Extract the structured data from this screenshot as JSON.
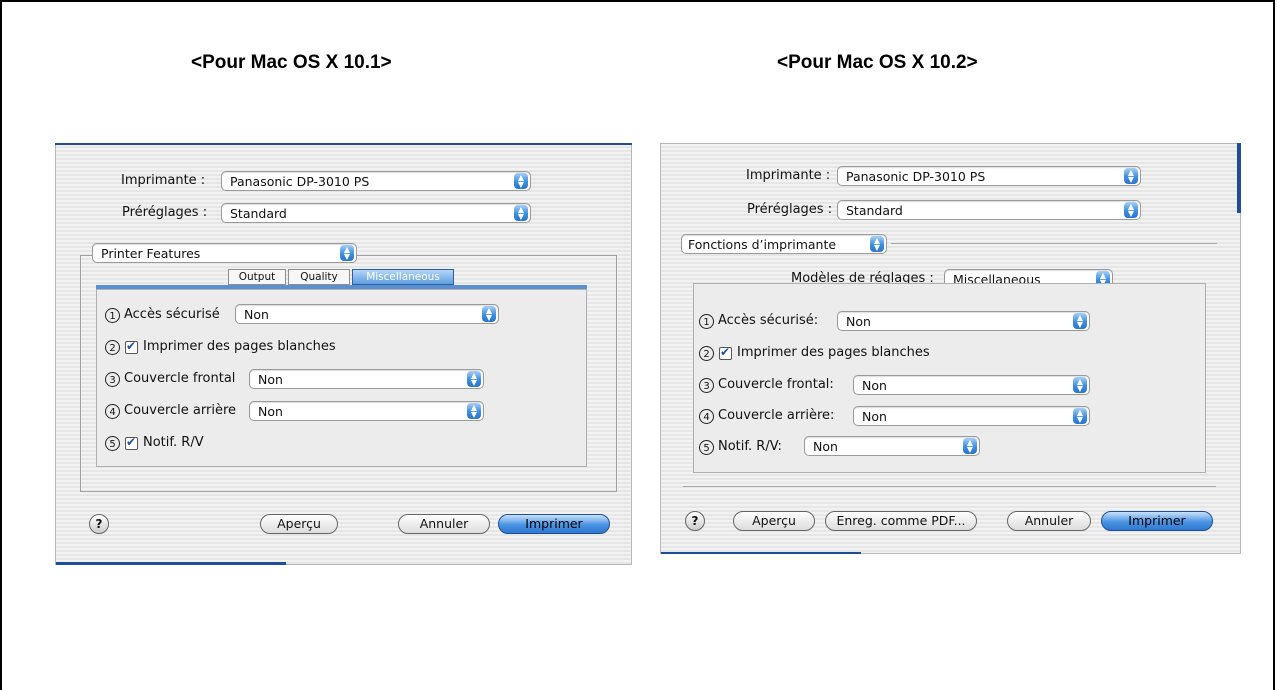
{
  "headings": {
    "left": "<Pour Mac OS X 10.1>",
    "right": "<Pour Mac OS X 10.2>"
  },
  "dialog1": {
    "printer_label": "Imprimante :",
    "printer_value": "Panasonic DP-3010 PS",
    "presets_label": "Préréglages :",
    "presets_value": "Standard",
    "section_value": "Printer Features",
    "tabs": [
      "Output",
      "Quality",
      "Miscellaneous"
    ],
    "selected_tab": "Miscellaneous",
    "rows": [
      {
        "num": "1",
        "label": "Accès sécurisé",
        "value": "Non"
      },
      {
        "num": "2",
        "label": "Imprimer des pages blanches",
        "checked": true
      },
      {
        "num": "3",
        "label": "Couvercle frontal",
        "value": "Non"
      },
      {
        "num": "4",
        "label": "Couvercle arrière",
        "value": "Non"
      },
      {
        "num": "5",
        "label": "Notif. R/V",
        "checked": true
      }
    ],
    "help": "?",
    "preview_button": "Aperçu",
    "cancel_button": "Annuler",
    "print_button": "Imprimer"
  },
  "dialog2": {
    "printer_label": "Imprimante :",
    "printer_value": "Panasonic DP-3010 PS",
    "presets_label": "Préréglages :",
    "presets_value": "Standard",
    "section_value": "Fonctions d’imprimante",
    "models_label": "Modèles de réglages :",
    "models_value": "Miscellaneous",
    "rows": [
      {
        "num": "1",
        "label": "Accès sécurisé:",
        "value": "Non"
      },
      {
        "num": "2",
        "label": "Imprimer des pages blanches",
        "checked": true
      },
      {
        "num": "3",
        "label": "Couvercle frontal:",
        "value": "Non"
      },
      {
        "num": "4",
        "label": "Couvercle arrière:",
        "value": "Non"
      },
      {
        "num": "5",
        "label": "Notif. R/V:",
        "value": "Non"
      }
    ],
    "help": "?",
    "preview_button": "Aperçu",
    "pdf_button": "Enreg. comme PDF...",
    "cancel_button": "Annuler",
    "print_button": "Imprimer"
  },
  "colors": {
    "accent": "#3c8ee0",
    "frame": "#000000"
  },
  "icons": {
    "popup_arrows": "updown-arrows-icon",
    "help": "help-icon",
    "checkbox": "checkmark-icon"
  }
}
